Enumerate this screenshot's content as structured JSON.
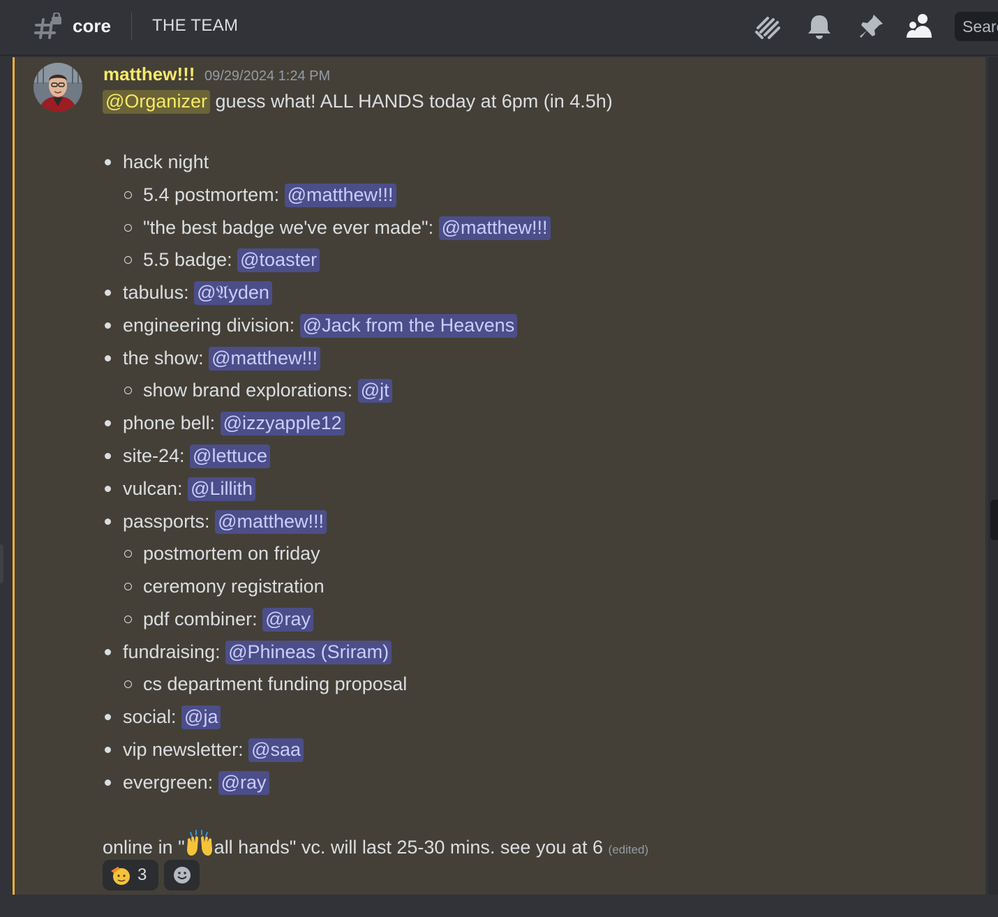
{
  "header": {
    "channel_name": "core",
    "topic": "THE TEAM",
    "icons": [
      "threads-icon",
      "bell-icon",
      "pin-icon",
      "member-list-icon"
    ],
    "search_placeholder": "Search"
  },
  "message": {
    "author": "matthew!!!",
    "author_color": "#f7e96a",
    "timestamp": "09/29/2024 1:24 PM",
    "intro_mention": "@Organizer",
    "intro_text": " guess what! ALL HANDS today at 6pm (in 4.5h)",
    "items": [
      {
        "level": 1,
        "text": "hack night",
        "mention": ""
      },
      {
        "level": 2,
        "text": "5.4 postmortem: ",
        "mention": "@matthew!!!"
      },
      {
        "level": 2,
        "text": "\"the best badge we've ever made\": ",
        "mention": "@matthew!!!"
      },
      {
        "level": 2,
        "text": "5.5 badge: ",
        "mention": "@toaster"
      },
      {
        "level": 1,
        "text": "tabulus: ",
        "mention": "@𝔄yden"
      },
      {
        "level": 1,
        "text": "engineering division: ",
        "mention": "@Jack from the Heavens"
      },
      {
        "level": 1,
        "text": "the show: ",
        "mention": "@matthew!!!"
      },
      {
        "level": 2,
        "text": "show brand explorations: ",
        "mention": "@jt"
      },
      {
        "level": 1,
        "text": "phone bell: ",
        "mention": "@izzyapple12"
      },
      {
        "level": 1,
        "text": "site-24: ",
        "mention": "@lettuce"
      },
      {
        "level": 1,
        "text": "vulcan: ",
        "mention": "@Lillith"
      },
      {
        "level": 1,
        "text": "passports: ",
        "mention": "@matthew!!!"
      },
      {
        "level": 2,
        "text": "postmortem on friday",
        "mention": ""
      },
      {
        "level": 2,
        "text": "ceremony registration",
        "mention": ""
      },
      {
        "level": 2,
        "text": "pdf combiner: ",
        "mention": "@ray"
      },
      {
        "level": 1,
        "text": "fundraising: ",
        "mention": "@Phineas (Sriram)"
      },
      {
        "level": 2,
        "text": "cs department funding proposal",
        "mention": ""
      },
      {
        "level": 1,
        "text": "social: ",
        "mention": "@ja"
      },
      {
        "level": 1,
        "text": "vip newsletter: ",
        "mention": "@saa"
      },
      {
        "level": 1,
        "text": "evergreen: ",
        "mention": "@ray"
      }
    ],
    "footer_before": "online in \"",
    "footer_emoji": "raising-hands-emoji",
    "footer_after": "all hands\" vc. will last 25-30 mins. see you at 6 ",
    "edited_label": "(edited)",
    "reactions": [
      {
        "emoji": "saluting-face-emoji",
        "count": "3"
      },
      {
        "emoji": "add-reaction-icon",
        "count": ""
      }
    ]
  },
  "colors": {
    "highlight_bg": "#444038",
    "highlight_border": "#f0b232",
    "mention_bg": "#4c4e8a",
    "mention_text": "#c9cdfb"
  }
}
